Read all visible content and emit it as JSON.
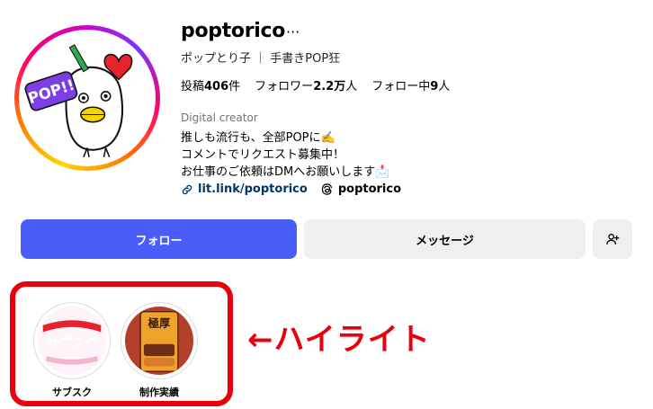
{
  "profile": {
    "username": "poptorico",
    "more_icon": "···",
    "full_name": "ポップとり子 ｜ 手書きPOP狂",
    "avatar_text": "POP!!",
    "stats": {
      "posts_label": "投稿",
      "posts_value": "406",
      "posts_unit": "件",
      "followers_label": "フォロワー",
      "followers_value": "2.2万",
      "followers_unit": "人",
      "following_label": "フォロー中",
      "following_value": "9",
      "following_unit": "人"
    },
    "category": "Digital creator",
    "bio": [
      "推しも流行も、全部POPに✍️",
      "コメントでリクエスト募集中！",
      "お仕事のご依頼はDMへお願いします📩"
    ],
    "link_text": "lit.link/poptorico",
    "threads_text": "poptorico"
  },
  "actions": {
    "follow_label": "フォロー",
    "message_label": "メッセージ",
    "add_user_icon": "add-user-icon"
  },
  "highlights": [
    {
      "label": "サブスク",
      "cover_text": "サブスク"
    },
    {
      "label": "制作実績",
      "cover_text": "極厚"
    }
  ],
  "annotation": "←ハイライト",
  "colors": {
    "follow_button": "#4a5df9",
    "secondary_button": "#efefef",
    "link": "#00376b",
    "annotation_red": "#e8000b"
  }
}
